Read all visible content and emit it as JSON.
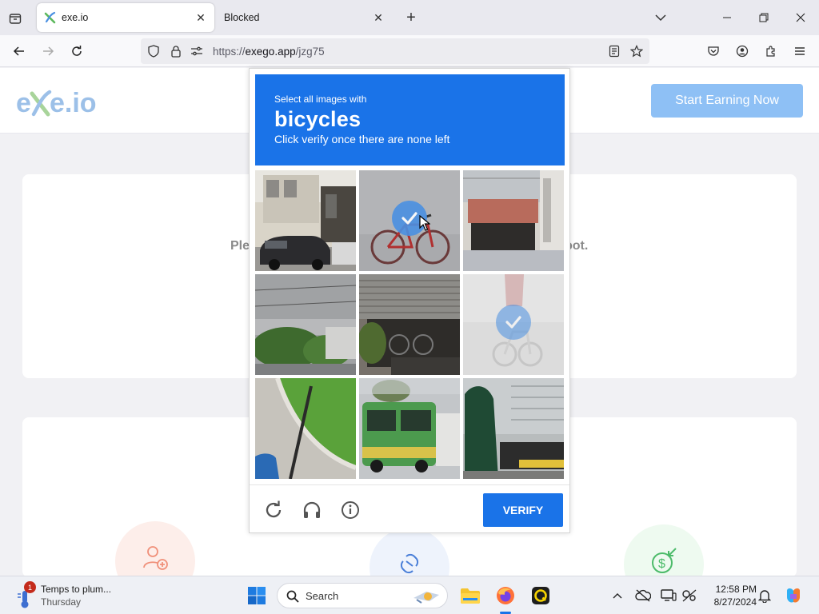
{
  "browser": {
    "tabs": [
      {
        "title": "exe.io",
        "active": true
      },
      {
        "title": "Blocked",
        "active": false
      }
    ],
    "url_prefix": "https://",
    "url_host": "exego.app",
    "url_path": "/jzg75"
  },
  "site": {
    "logo_text": "exe.io",
    "cta_label": "Start Earning Now",
    "card_text_left": "Ple",
    "card_text_right": "pot."
  },
  "captcha": {
    "subtitle": "Select all images with",
    "target": "bicycles",
    "instruction": "Click verify once there are none left",
    "verify_label": "VERIFY",
    "selected_tiles": [
      1,
      5
    ]
  },
  "taskbar": {
    "weather_badge": "1",
    "weather_title": "Temps to plum...",
    "weather_day": "Thursday",
    "search_label": "Search",
    "time": "12:58 PM",
    "date": "8/27/2024"
  },
  "colors": {
    "accent": "#1a73e8",
    "cta": "#8ec0f5",
    "check": "#4a90e2"
  }
}
